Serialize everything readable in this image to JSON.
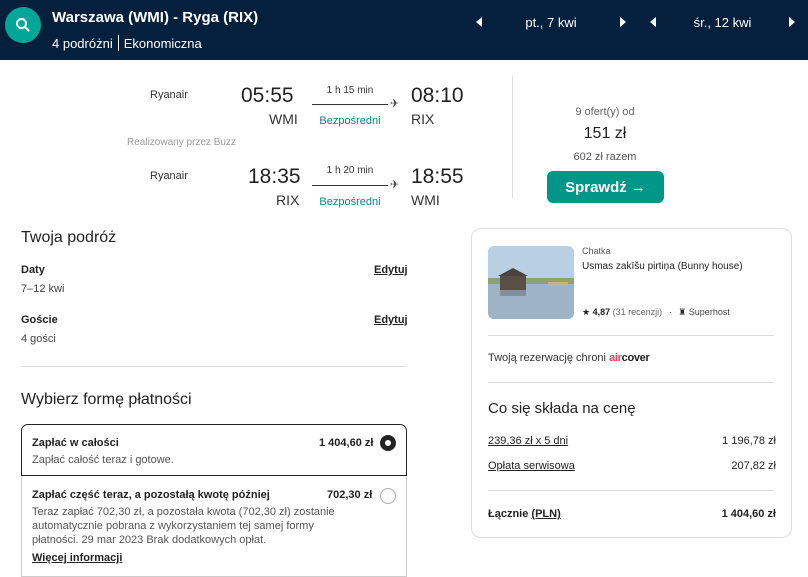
{
  "header": {
    "route": "Warszawa (WMI) - Ryga (RIX)",
    "travelers": "4 podróżni",
    "cabin": "Ekonomiczna",
    "outbound_date": "pt., 7 kwi",
    "return_date": "śr., 12 kwi"
  },
  "flights": {
    "outbound": {
      "airline": "Ryanair",
      "depart_time": "05:55",
      "depart_code": "WMI",
      "duration": "1 h 15 min",
      "stops": "Bezpośredni",
      "arrive_time": "08:10",
      "arrive_code": "RIX"
    },
    "operated_by": "Realizowany przez Buzz",
    "return": {
      "airline": "Ryanair",
      "depart_time": "18:35",
      "depart_code": "RIX",
      "duration": "1 h 20 min",
      "stops": "Bezpośredni",
      "arrive_time": "18:55",
      "arrive_code": "WMI"
    },
    "offers": "9 ofert(y) od",
    "price": "151 zł",
    "total": "602 zł razem",
    "check_label": "Sprawdź →"
  },
  "trip": {
    "title": "Twoja podróż",
    "dates_label": "Daty",
    "dates_value": "7–12 kwi",
    "guests_label": "Goście",
    "guests_value": "4 gości",
    "edit_label": "Edytuj"
  },
  "payment": {
    "title": "Wybierz formę płatności",
    "full_label": "Zapłać w całości",
    "full_amount": "1 404,60 zł",
    "full_desc": "Zapłać całość teraz i gotowe.",
    "part_label": "Zapłać część teraz, a pozostałą kwotę później",
    "part_amount": "702,30 zł",
    "part_desc_1": "Teraz zapłać 702,30 zł, a pozostała kwota (702,30 zł) zostanie",
    "part_desc_2": "automatycznie pobrana z wykorzystaniem tej samej formy",
    "part_desc_3": "płatności. 29 mar 2023 Brak dodatkowych opłat.",
    "more_info": "Więcej informacji"
  },
  "listing": {
    "type": "Chatka",
    "name": "Usmas zakīšu pirtiņa (Bunny house)",
    "rating": "4,87",
    "reviews": "(31 recenzji)",
    "dot": "·",
    "superhost": "Superhost",
    "protect_text": "Twoją rezerwację chroni",
    "aircover_air": "air",
    "aircover_cover": "cover",
    "price_title": "Co się składa na cenę",
    "nights_label": "239,36 zł x 5 dni",
    "nights_value": "1 196,78 zł",
    "fee_label": "Opłata serwisowa",
    "fee_value": "207,82 zł",
    "total_label": "Łącznie",
    "total_currency": "(PLN)",
    "total_value": "1 404,60 zł",
    "brand_color": "#ff385c"
  }
}
